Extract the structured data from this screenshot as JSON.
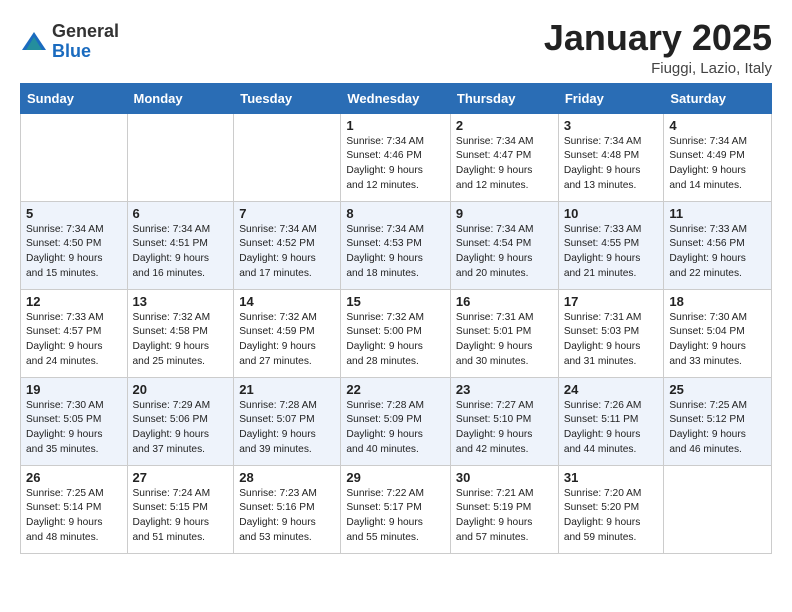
{
  "logo": {
    "general": "General",
    "blue": "Blue"
  },
  "title": "January 2025",
  "location": "Fiuggi, Lazio, Italy",
  "weekdays": [
    "Sunday",
    "Monday",
    "Tuesday",
    "Wednesday",
    "Thursday",
    "Friday",
    "Saturday"
  ],
  "weeks": [
    {
      "alt": false,
      "days": [
        {
          "num": "",
          "info": ""
        },
        {
          "num": "",
          "info": ""
        },
        {
          "num": "",
          "info": ""
        },
        {
          "num": "1",
          "info": "Sunrise: 7:34 AM\nSunset: 4:46 PM\nDaylight: 9 hours\nand 12 minutes."
        },
        {
          "num": "2",
          "info": "Sunrise: 7:34 AM\nSunset: 4:47 PM\nDaylight: 9 hours\nand 12 minutes."
        },
        {
          "num": "3",
          "info": "Sunrise: 7:34 AM\nSunset: 4:48 PM\nDaylight: 9 hours\nand 13 minutes."
        },
        {
          "num": "4",
          "info": "Sunrise: 7:34 AM\nSunset: 4:49 PM\nDaylight: 9 hours\nand 14 minutes."
        }
      ]
    },
    {
      "alt": true,
      "days": [
        {
          "num": "5",
          "info": "Sunrise: 7:34 AM\nSunset: 4:50 PM\nDaylight: 9 hours\nand 15 minutes."
        },
        {
          "num": "6",
          "info": "Sunrise: 7:34 AM\nSunset: 4:51 PM\nDaylight: 9 hours\nand 16 minutes."
        },
        {
          "num": "7",
          "info": "Sunrise: 7:34 AM\nSunset: 4:52 PM\nDaylight: 9 hours\nand 17 minutes."
        },
        {
          "num": "8",
          "info": "Sunrise: 7:34 AM\nSunset: 4:53 PM\nDaylight: 9 hours\nand 18 minutes."
        },
        {
          "num": "9",
          "info": "Sunrise: 7:34 AM\nSunset: 4:54 PM\nDaylight: 9 hours\nand 20 minutes."
        },
        {
          "num": "10",
          "info": "Sunrise: 7:33 AM\nSunset: 4:55 PM\nDaylight: 9 hours\nand 21 minutes."
        },
        {
          "num": "11",
          "info": "Sunrise: 7:33 AM\nSunset: 4:56 PM\nDaylight: 9 hours\nand 22 minutes."
        }
      ]
    },
    {
      "alt": false,
      "days": [
        {
          "num": "12",
          "info": "Sunrise: 7:33 AM\nSunset: 4:57 PM\nDaylight: 9 hours\nand 24 minutes."
        },
        {
          "num": "13",
          "info": "Sunrise: 7:32 AM\nSunset: 4:58 PM\nDaylight: 9 hours\nand 25 minutes."
        },
        {
          "num": "14",
          "info": "Sunrise: 7:32 AM\nSunset: 4:59 PM\nDaylight: 9 hours\nand 27 minutes."
        },
        {
          "num": "15",
          "info": "Sunrise: 7:32 AM\nSunset: 5:00 PM\nDaylight: 9 hours\nand 28 minutes."
        },
        {
          "num": "16",
          "info": "Sunrise: 7:31 AM\nSunset: 5:01 PM\nDaylight: 9 hours\nand 30 minutes."
        },
        {
          "num": "17",
          "info": "Sunrise: 7:31 AM\nSunset: 5:03 PM\nDaylight: 9 hours\nand 31 minutes."
        },
        {
          "num": "18",
          "info": "Sunrise: 7:30 AM\nSunset: 5:04 PM\nDaylight: 9 hours\nand 33 minutes."
        }
      ]
    },
    {
      "alt": true,
      "days": [
        {
          "num": "19",
          "info": "Sunrise: 7:30 AM\nSunset: 5:05 PM\nDaylight: 9 hours\nand 35 minutes."
        },
        {
          "num": "20",
          "info": "Sunrise: 7:29 AM\nSunset: 5:06 PM\nDaylight: 9 hours\nand 37 minutes."
        },
        {
          "num": "21",
          "info": "Sunrise: 7:28 AM\nSunset: 5:07 PM\nDaylight: 9 hours\nand 39 minutes."
        },
        {
          "num": "22",
          "info": "Sunrise: 7:28 AM\nSunset: 5:09 PM\nDaylight: 9 hours\nand 40 minutes."
        },
        {
          "num": "23",
          "info": "Sunrise: 7:27 AM\nSunset: 5:10 PM\nDaylight: 9 hours\nand 42 minutes."
        },
        {
          "num": "24",
          "info": "Sunrise: 7:26 AM\nSunset: 5:11 PM\nDaylight: 9 hours\nand 44 minutes."
        },
        {
          "num": "25",
          "info": "Sunrise: 7:25 AM\nSunset: 5:12 PM\nDaylight: 9 hours\nand 46 minutes."
        }
      ]
    },
    {
      "alt": false,
      "days": [
        {
          "num": "26",
          "info": "Sunrise: 7:25 AM\nSunset: 5:14 PM\nDaylight: 9 hours\nand 48 minutes."
        },
        {
          "num": "27",
          "info": "Sunrise: 7:24 AM\nSunset: 5:15 PM\nDaylight: 9 hours\nand 51 minutes."
        },
        {
          "num": "28",
          "info": "Sunrise: 7:23 AM\nSunset: 5:16 PM\nDaylight: 9 hours\nand 53 minutes."
        },
        {
          "num": "29",
          "info": "Sunrise: 7:22 AM\nSunset: 5:17 PM\nDaylight: 9 hours\nand 55 minutes."
        },
        {
          "num": "30",
          "info": "Sunrise: 7:21 AM\nSunset: 5:19 PM\nDaylight: 9 hours\nand 57 minutes."
        },
        {
          "num": "31",
          "info": "Sunrise: 7:20 AM\nSunset: 5:20 PM\nDaylight: 9 hours\nand 59 minutes."
        },
        {
          "num": "",
          "info": ""
        }
      ]
    }
  ]
}
